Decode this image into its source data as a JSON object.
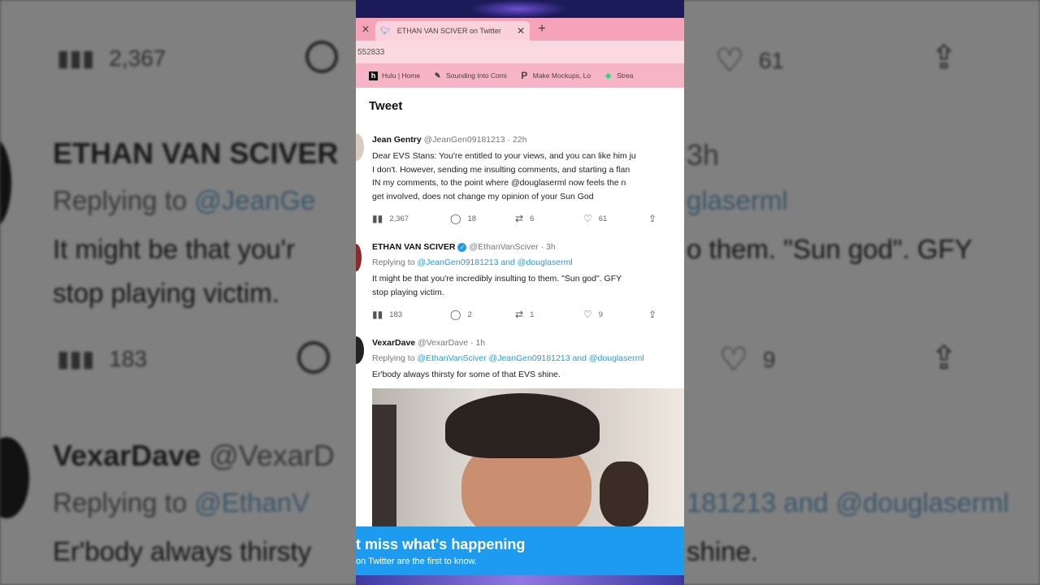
{
  "background": {
    "rows": [
      {
        "views": "2,367",
        "likes": "61"
      },
      {
        "views": "183",
        "likes": "9"
      }
    ],
    "tweet2": {
      "name": "ETHAN VAN SCIVER",
      "time": "3h",
      "replying_prefix": "Replying to",
      "replying_left": "@JeanGe",
      "replying_right": "glaserml",
      "text_line1_left": "It might be that you'r",
      "text_line1_right": "o them.  \"Sun god\".  GFY",
      "text_line2": "stop playing victim."
    },
    "tweet3": {
      "name": "VexarDave",
      "handle": "@VexarD",
      "replying_prefix": "Replying to",
      "replying_left": "@EthanV",
      "replying_right": "181213 and @douglaserml",
      "text_left": "Er'body always thirsty",
      "text_right": "shine."
    }
  },
  "browser": {
    "tab_title": "ETHAN VAN SCIVER on Twitter",
    "url_fragment": "552833",
    "bookmarks": [
      {
        "icon": "h",
        "label": "Hulu | Home"
      },
      {
        "icon": "✎",
        "label": "Sounding Into Comi"
      },
      {
        "icon": "P",
        "label": "Make Mockups, Lo"
      },
      {
        "icon": "◆",
        "label": "Strea"
      }
    ]
  },
  "page": {
    "title": "Tweet"
  },
  "tweets": [
    {
      "name": "Jean Gentry",
      "handle": "@JeanGen09181213",
      "time": "22h",
      "lines": [
        "Dear EVS Stans: You're entitled to your views, and you can like him ju",
        "I don't. However, sending me insulting comments, and starting a flan",
        "IN my comments, to the point where @douglaserml now feels the n",
        "get involved, does not change my opinion of your Sun God"
      ],
      "views": "2,367",
      "replies": "18",
      "retweets": "6",
      "likes": "61"
    },
    {
      "name": "ETHAN VAN SCIVER",
      "handle": "@EthanVanSciver",
      "time": "3h",
      "replying_prefix": "Replying to",
      "replying_to": "@JeanGen09181213 and @douglaserml",
      "lines": [
        "It might be that you're incredibly insulting to them.  \"Sun god\".  GFY",
        "stop playing victim."
      ],
      "views": "183",
      "replies": "2",
      "retweets": "1",
      "likes": "9"
    },
    {
      "name": "VexarDave",
      "handle": "@VexarDave",
      "time": "1h",
      "replying_prefix": "Replying to",
      "replying_to": "@EthanVanSciver @JeanGen09181213 and @douglaserml",
      "lines": [
        "Er'body always thirsty for some of that EVS shine."
      ]
    }
  ],
  "banner": {
    "title": "t miss what's happening",
    "subtitle": "on Twitter are the first to know."
  },
  "colors": {
    "twitter_blue": "#1d9bf0",
    "tab_bar_pink": "#f6a3ba"
  }
}
